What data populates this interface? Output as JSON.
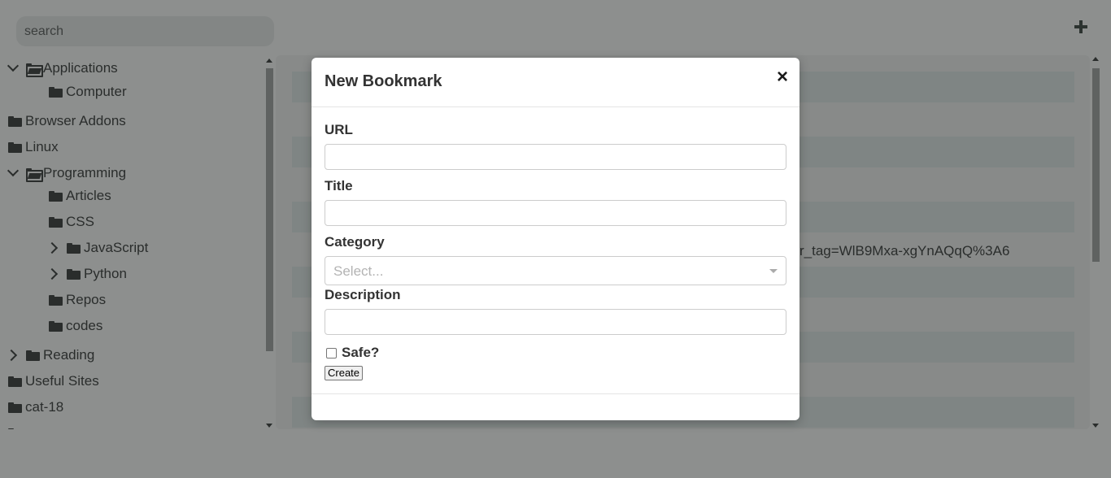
{
  "search": {
    "placeholder": "search"
  },
  "sidebar": {
    "items": [
      {
        "label": "Applications",
        "expanded": true
      },
      {
        "label": "Computer"
      },
      {
        "label": "Browser Addons"
      },
      {
        "label": "Linux"
      },
      {
        "label": "Programming",
        "expanded": true
      },
      {
        "label": "Articles"
      },
      {
        "label": "CSS"
      },
      {
        "label": "JavaScript",
        "expanded": false
      },
      {
        "label": "Python",
        "expanded": false
      },
      {
        "label": "Repos"
      },
      {
        "label": "codes"
      },
      {
        "label": "Reading",
        "expanded": false
      },
      {
        "label": "Useful Sites"
      },
      {
        "label": "cat-18"
      }
    ]
  },
  "main": {
    "visible_url_fragment": "r_tag=WlB9Mxa-xgYnAQqQ%3A6"
  },
  "modal": {
    "title": "New Bookmark",
    "close_symbol": "×",
    "url_label": "URL",
    "url_value": "",
    "title_label": "Title",
    "title_value": "",
    "category_label": "Category",
    "category_placeholder": "Select...",
    "description_label": "Description",
    "description_value": "",
    "safe_label": "Safe?",
    "safe_checked": false,
    "create_label": "Create"
  }
}
